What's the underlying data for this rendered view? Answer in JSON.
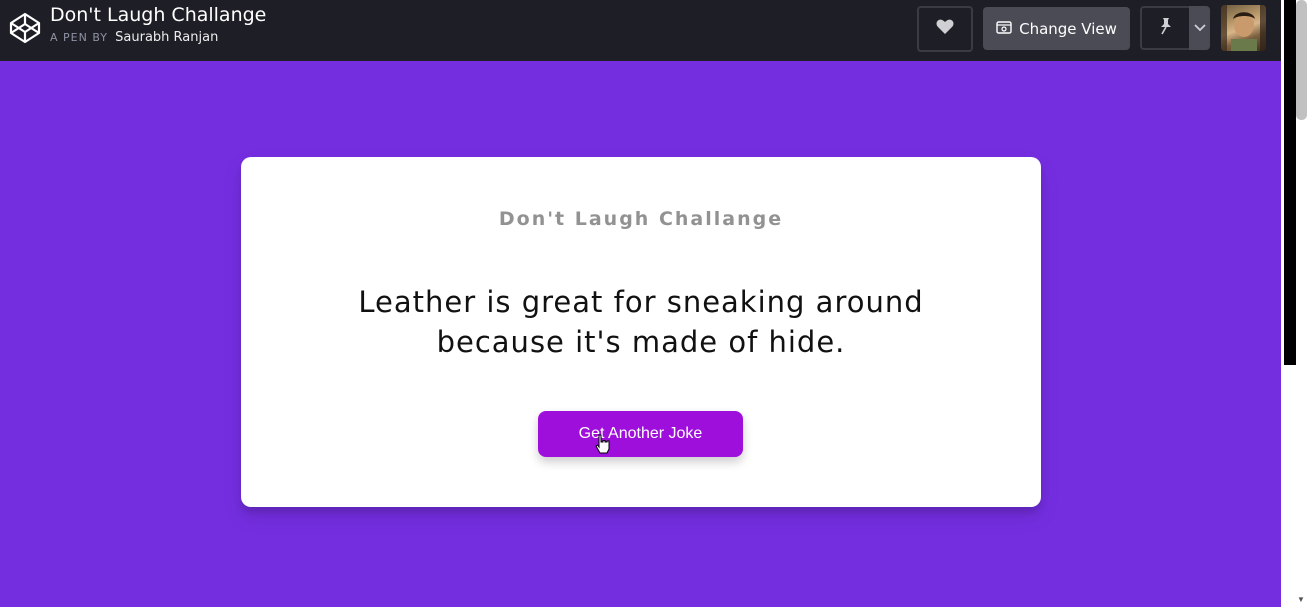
{
  "header": {
    "pen_title": "Don't Laugh Challange",
    "pen_by_label": "A PEN BY",
    "author": "Saurabh Ranjan",
    "change_view_label": "Change View",
    "icons": {
      "logo": "codepen-logo-icon",
      "heart": "heart-icon",
      "view": "view-icon",
      "pin": "pin-icon",
      "dropdown": "chevron-down-icon"
    }
  },
  "card": {
    "heading": "Don't Laugh Challange",
    "joke": "Leather is great for sneaking around because it's made of hide.",
    "button_label": "Get Another Joke"
  },
  "colors": {
    "background": "#742ee0",
    "topbar": "#1e1f26",
    "button": "#9f0fdc"
  }
}
